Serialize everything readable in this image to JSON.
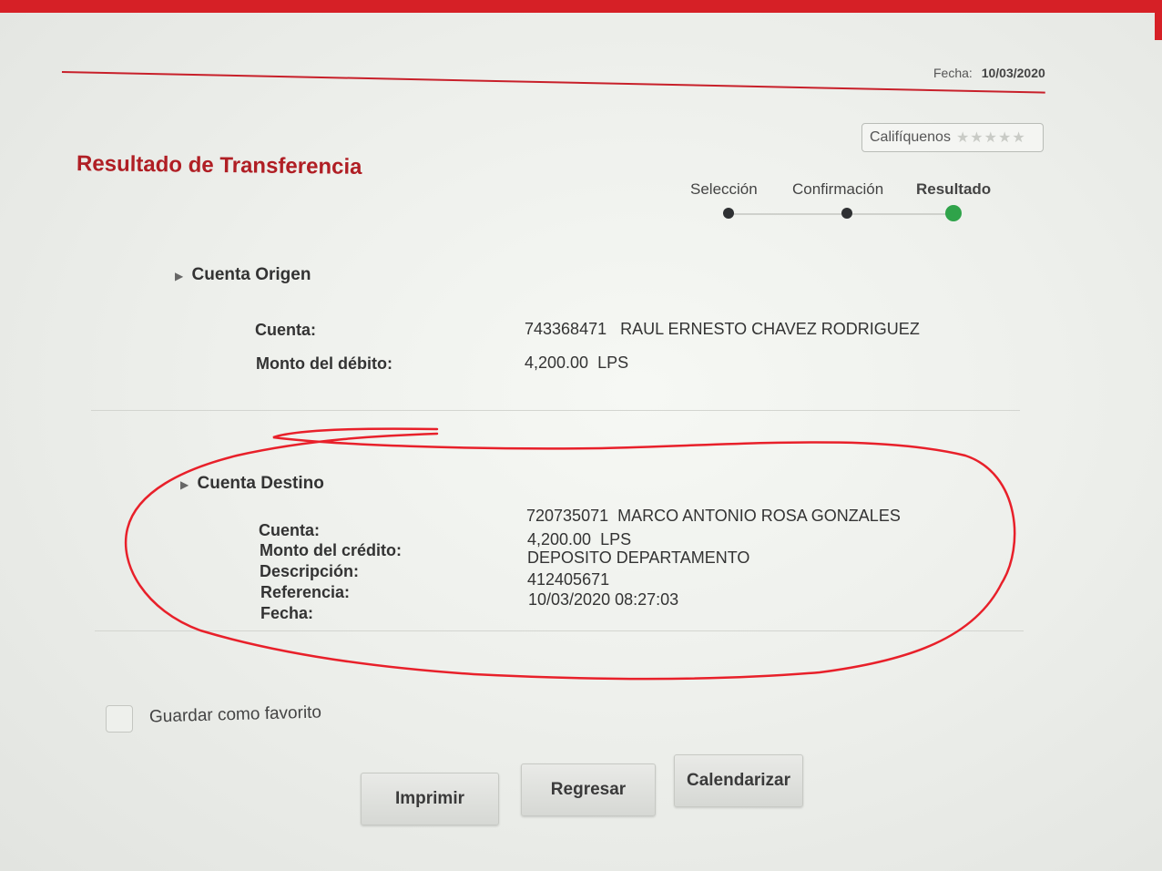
{
  "header": {
    "fecha_label": "Fecha:",
    "fecha_value": "10/03/2020",
    "rating_label": "Califíquenos",
    "rating_stars": "★★★★★",
    "title": "Resultado de Transferencia"
  },
  "steps": [
    {
      "label": "Selección",
      "state": "done"
    },
    {
      "label": "Confirmación",
      "state": "done"
    },
    {
      "label": "Resultado",
      "state": "active"
    }
  ],
  "origen": {
    "heading": "Cuenta Origen",
    "cuenta_label": "Cuenta:",
    "cuenta_value": "743368471   RAUL ERNESTO CHAVEZ RODRIGUEZ",
    "monto_label": "Monto del débito:",
    "monto_value": "4,200.00  LPS"
  },
  "destino": {
    "heading": "Cuenta Destino",
    "cuenta_label": "Cuenta:",
    "cuenta_value": "720735071  MARCO ANTONIO ROSA GONZALES",
    "monto_label": "Monto del crédito:",
    "monto_value": "4,200.00  LPS",
    "descripcion_label": "Descripción:",
    "descripcion_value": "DEPOSITO DEPARTAMENTO",
    "referencia_label": "Referencia:",
    "referencia_value": "412405671",
    "fecha_label": "Fecha:",
    "fecha_value": "10/03/2020 08:27:03"
  },
  "favorite": {
    "label": "Guardar como favorito"
  },
  "buttons": {
    "imprimir": "Imprimir",
    "regresar": "Regresar",
    "calendarizar": "Calendarizar"
  },
  "colors": {
    "brand_red": "#b01e24",
    "active_step": "#2fa34a",
    "annotation": "#e8202a"
  }
}
